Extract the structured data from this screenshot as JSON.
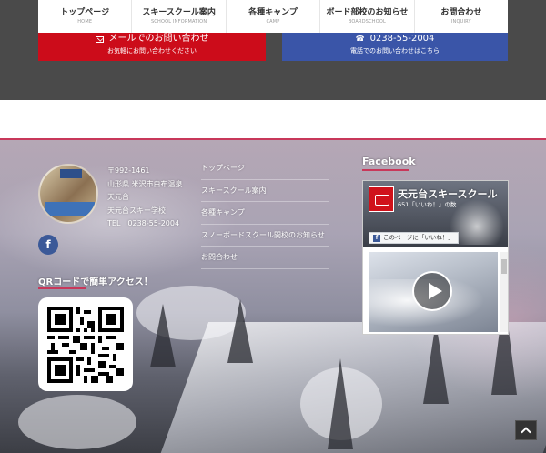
{
  "nav": {
    "items": [
      {
        "main": "トップページ",
        "sub": "HOME"
      },
      {
        "main": "スキースクール案内",
        "sub": "SCHOOL INFORMATION"
      },
      {
        "main": "各種キャンプ",
        "sub": "CAMP"
      },
      {
        "main": "ボード部校のお知らせ",
        "sub": "BOARDSCHOOL"
      },
      {
        "main": "お問合わせ",
        "sub": "INQUIRY"
      }
    ]
  },
  "contact": {
    "mail_title": "メールでのお問い合わせ",
    "mail_sub": "お気軽にお問い合わせください",
    "tel_title": "0238-55-2004",
    "tel_sub": "電話でのお問い合わせはこちら"
  },
  "address": {
    "postal": "〒992-1461",
    "line1": "山形県 米沢市白布温泉",
    "line2": "天元台",
    "line3": "天元台スキー学校",
    "tel": "TEL　0238-55-2004"
  },
  "qr": {
    "title": "QRコードで簡単アクセス！"
  },
  "footer_nav": {
    "items": [
      "トップページ",
      "スキースクール案内",
      "各種キャンプ",
      "スノーボードスクール開校のお知らせ",
      "お問合わせ"
    ]
  },
  "facebook": {
    "heading": "Facebook",
    "page_name": "天元台スキースクール",
    "likes": "651「いいね！」の数",
    "like_button": "このページに「いいね！」",
    "fb_letter": "f"
  },
  "icons": {
    "facebook": "facebook-icon",
    "mail": "mail-icon",
    "phone": "phone-icon",
    "to_top": "chevron-up-icon"
  },
  "colors": {
    "mail_red": "#cc0c1a",
    "tel_blue": "#3a55a8",
    "accent_pink": "#c8385a",
    "facebook_blue": "#3b5998"
  }
}
